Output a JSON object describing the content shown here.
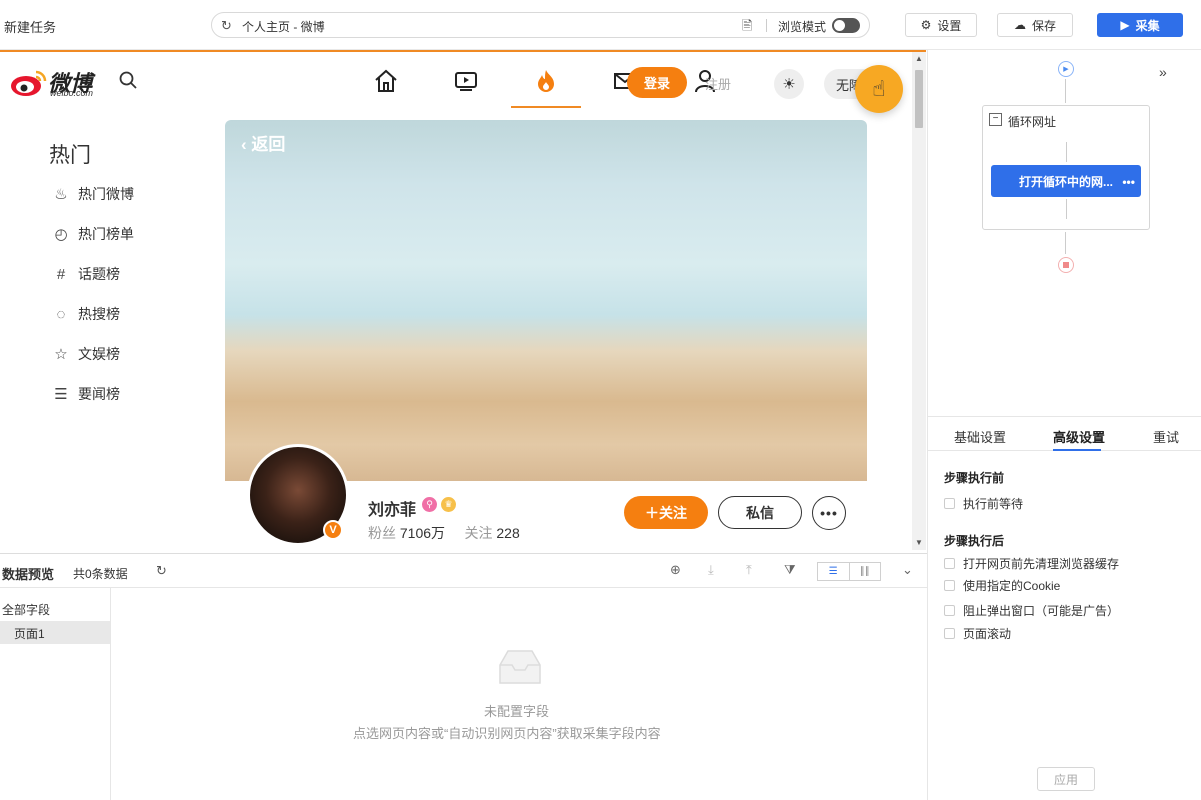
{
  "app": {
    "task_name": "新建任务"
  },
  "urlbar": {
    "url_text": "个人主页 - 微博",
    "browse_mode_label": "浏览模式"
  },
  "toolbar": {
    "settings_label": "设置",
    "save_label": "保存",
    "collect_label": "采集"
  },
  "weibo": {
    "logo_text": "微博",
    "logo_sub": "weibo.com",
    "login_label": "登录",
    "register_label": "注册",
    "access_label": "无障",
    "sidebar_title": "热门",
    "sidebar_items": [
      {
        "label": "热门微博",
        "icon": "flame-icon"
      },
      {
        "label": "热门榜单",
        "icon": "clock-icon"
      },
      {
        "label": "话题榜",
        "icon": "hash-icon"
      },
      {
        "label": "热搜榜",
        "icon": "search-circle-icon"
      },
      {
        "label": "文娱榜",
        "icon": "star-icon"
      },
      {
        "label": "要闻榜",
        "icon": "news-icon"
      }
    ],
    "back_label": "返回",
    "profile": {
      "name": "刘亦菲",
      "fans_label": "粉丝",
      "fans_value": "7106万",
      "follow_label": "关注",
      "follow_value": "228",
      "verified_badge": "V"
    },
    "follow_button": "关注",
    "message_button": "私信",
    "more_button": "•••"
  },
  "preview": {
    "title": "数据预览",
    "count_text": "共0条数据",
    "all_fields_label": "全部字段",
    "page_label": "页面1",
    "empty_title": "未配置字段",
    "empty_hint": "点选网页内容或“自动识别网页内容”获取采集字段内容"
  },
  "flow": {
    "loop_label": "循环网址",
    "loop_step_label": "打开循环中的网...",
    "loop_step_more": "•••"
  },
  "settings_panel": {
    "tabs": [
      "基础设置",
      "高级设置",
      "重试"
    ],
    "active_tab": "高级设置",
    "before_title": "步骤执行前",
    "before_options": [
      "执行前等待"
    ],
    "after_title": "步骤执行后",
    "after_options": [
      "打开网页前先清理浏览器缓存",
      "使用指定的Cookie",
      "阻止弹出窗口（可能是广告）",
      "页面滚动"
    ],
    "apply_label": "应用"
  },
  "colors": {
    "accent_blue": "#2f6fe9",
    "weibo_orange": "#f57f10",
    "tab_underline": "#f08a24"
  }
}
